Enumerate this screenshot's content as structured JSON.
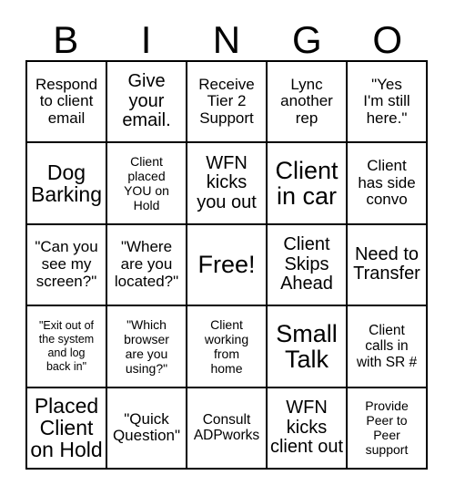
{
  "header": {
    "letters": [
      "B",
      "I",
      "N",
      "G",
      "O"
    ]
  },
  "grid": {
    "columns": 5,
    "rows": 5,
    "cells": [
      {
        "text": "Respond\nto client\nemail",
        "size": "lg"
      },
      {
        "text": "Give\nyour\nemail.",
        "size": "xl"
      },
      {
        "text": "Receive\nTier 2\nSupport",
        "size": "lg"
      },
      {
        "text": "Lync\nanother\nrep",
        "size": "lg"
      },
      {
        "text": "\"Yes\nI'm still\nhere.\"",
        "size": "lg"
      },
      {
        "text": "Dog\nBarking",
        "size": "xxl"
      },
      {
        "text": "Client\nplaced\nYOU on\nHold",
        "size": "sm"
      },
      {
        "text": "WFN\nkicks\nyou out",
        "size": "xl"
      },
      {
        "text": "Client\nin car",
        "size": "huge"
      },
      {
        "text": "Client\nhas side\nconvo",
        "size": "lg"
      },
      {
        "text": "\"Can you\nsee my\nscreen?\"",
        "size": "lg"
      },
      {
        "text": "\"Where\nare you\nlocated?\"",
        "size": "lg"
      },
      {
        "text": "Free!",
        "size": "huge"
      },
      {
        "text": "Client\nSkips\nAhead",
        "size": "xl"
      },
      {
        "text": "Need to\nTransfer",
        "size": "xl"
      },
      {
        "text": "\"Exit out of\nthe system\nand log\nback in\"",
        "size": "xs"
      },
      {
        "text": "\"Which\nbrowser\nare you\nusing?\"",
        "size": "sm"
      },
      {
        "text": "Client\nworking\nfrom\nhome",
        "size": "sm"
      },
      {
        "text": "Small\nTalk",
        "size": "huge"
      },
      {
        "text": "Client\ncalls in\nwith SR #",
        "size": "md"
      },
      {
        "text": "Placed\nClient\non Hold",
        "size": "xxl"
      },
      {
        "text": "\"Quick\nQuestion\"",
        "size": "lg"
      },
      {
        "text": "Consult\nADPworks",
        "size": "md"
      },
      {
        "text": "WFN\nkicks\nclient out",
        "size": "xl"
      },
      {
        "text": "Provide\nPeer to\nPeer\nsupport",
        "size": "sm"
      }
    ]
  },
  "colors": {
    "background": "#ffffff",
    "text": "#000000",
    "border": "#000000"
  }
}
